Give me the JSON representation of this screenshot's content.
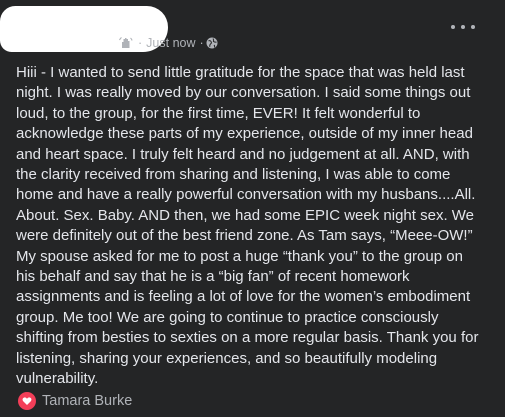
{
  "post": {
    "timestamp": "Just now",
    "separator": "·",
    "body": "Hiii - I wanted to send  little gratitude for the space that was held last\nnight. I was really moved by our conversation. I said some things out\nloud, to the group, for the first time, EVER! It felt wonderful to\nacknowledge these parts of my experience, outside of my inner head\nand heart space. I truly felt heard and no judgement at all. AND, with\nthe clarity received from sharing and listening, I was able to come\nhome and have a really powerful conversation with my husbans....All.\nAbout. Sex. Baby. AND then, we had some EPIC week night sex. We\nwere definitely out of the best friend zone. As Tam says, “Meee-OW!”\nMy spouse asked for me to post a huge “thank you” to the group on\nhis behalf and say that he is a “big fan” of recent homework\nassignments and is feeling a lot of love for the women’s embodiment\ngroup. Me too! We are going to continue to practice consciously\nshifting from besties to sexties on a more regular basis. Thank you for\nlistening, sharing your experiences, and so beautifully modeling\nvulnerability."
  },
  "reactions": {
    "reactor": "Tamara Burke",
    "icon": "love-reaction-icon"
  },
  "icons": {
    "wave": "wave-icon",
    "audience": "globe-icon",
    "more": "more-options-icon"
  },
  "colors": {
    "background": "#242526",
    "text": "#e4e6eb",
    "secondary_text": "#b0b3b8",
    "love": "#f33e58"
  }
}
